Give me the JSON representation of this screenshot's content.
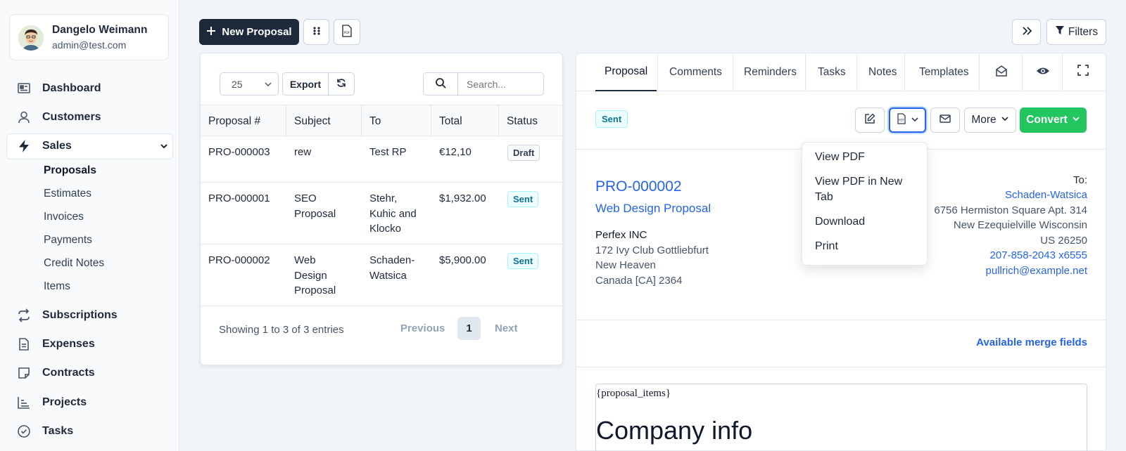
{
  "user": {
    "name": "Dangelo Weimann",
    "email": "admin@test.com"
  },
  "sidebar": {
    "items": [
      {
        "label": "Dashboard",
        "icon": "dashboard-icon"
      },
      {
        "label": "Customers",
        "icon": "user-icon"
      },
      {
        "label": "Sales",
        "icon": "bolt-icon",
        "active": true
      },
      {
        "label": "Subscriptions",
        "icon": "repeat-icon"
      },
      {
        "label": "Expenses",
        "icon": "file-icon"
      },
      {
        "label": "Contracts",
        "icon": "note-icon"
      },
      {
        "label": "Projects",
        "icon": "chart-icon"
      },
      {
        "label": "Tasks",
        "icon": "check-circle-icon"
      }
    ],
    "sub_items": [
      "Proposals",
      "Estimates",
      "Invoices",
      "Payments",
      "Credit Notes",
      "Items"
    ]
  },
  "toolbar": {
    "new_label": "New Proposal",
    "filters_label": "Filters",
    "pdf_label": "PDF"
  },
  "table": {
    "page_size": "25",
    "export_label": "Export",
    "search_placeholder": "Search...",
    "headers": [
      "Proposal #",
      "Subject",
      "To",
      "Total",
      "Status"
    ],
    "rows": [
      {
        "number": "PRO-000003",
        "subject": [
          "rew"
        ],
        "to": [
          "Test RP"
        ],
        "total": "€12,10",
        "status": "Draft"
      },
      {
        "number": "PRO-000001",
        "subject": [
          "SEO",
          "Proposal"
        ],
        "to": [
          "Stehr,",
          "Kuhic and",
          "Klocko"
        ],
        "total": "$1,932.00",
        "status": "Sent"
      },
      {
        "number": "PRO-000002",
        "subject": [
          "Web",
          "Design",
          "Proposal"
        ],
        "to": [
          "Schaden-",
          "Watsica"
        ],
        "total": "$5,900.00",
        "status": "Sent"
      }
    ],
    "showing": "Showing 1 to 3 of 3 entries",
    "prev": "Previous",
    "page": "1",
    "next": "Next"
  },
  "preview": {
    "tabs": [
      "Proposal",
      "Comments",
      "Reminders",
      "Tasks",
      "Notes",
      "Templates"
    ],
    "status": "Sent",
    "more_label": "More",
    "convert_label": "Convert",
    "number": "PRO-000002",
    "subject": "Web Design Proposal",
    "from": {
      "company": "Perfex INC",
      "lines": [
        "172 Ivy Club Gottliebfurt",
        "New Heaven",
        "Canada [CA] 2364"
      ]
    },
    "to": {
      "label": "To:",
      "company": "Schaden-Watsica",
      "lines": [
        "6756 Hermiston Square Apt. 314",
        "New Ezequielville Wisconsin",
        "US 26250"
      ],
      "phone": "207-858-2043 x6555",
      "email": "pullrich@example.net"
    },
    "merge_fields": "Available merge fields",
    "editor_tag": "{proposal_items}",
    "editor_heading": "Company info"
  },
  "pdf_menu": [
    "View PDF",
    "View PDF in New Tab",
    "Download",
    "Print"
  ],
  "colors": {
    "primary_dark": "#1e293b",
    "link": "#2563eb",
    "success": "#22c55e",
    "sent": "#0e7490"
  }
}
